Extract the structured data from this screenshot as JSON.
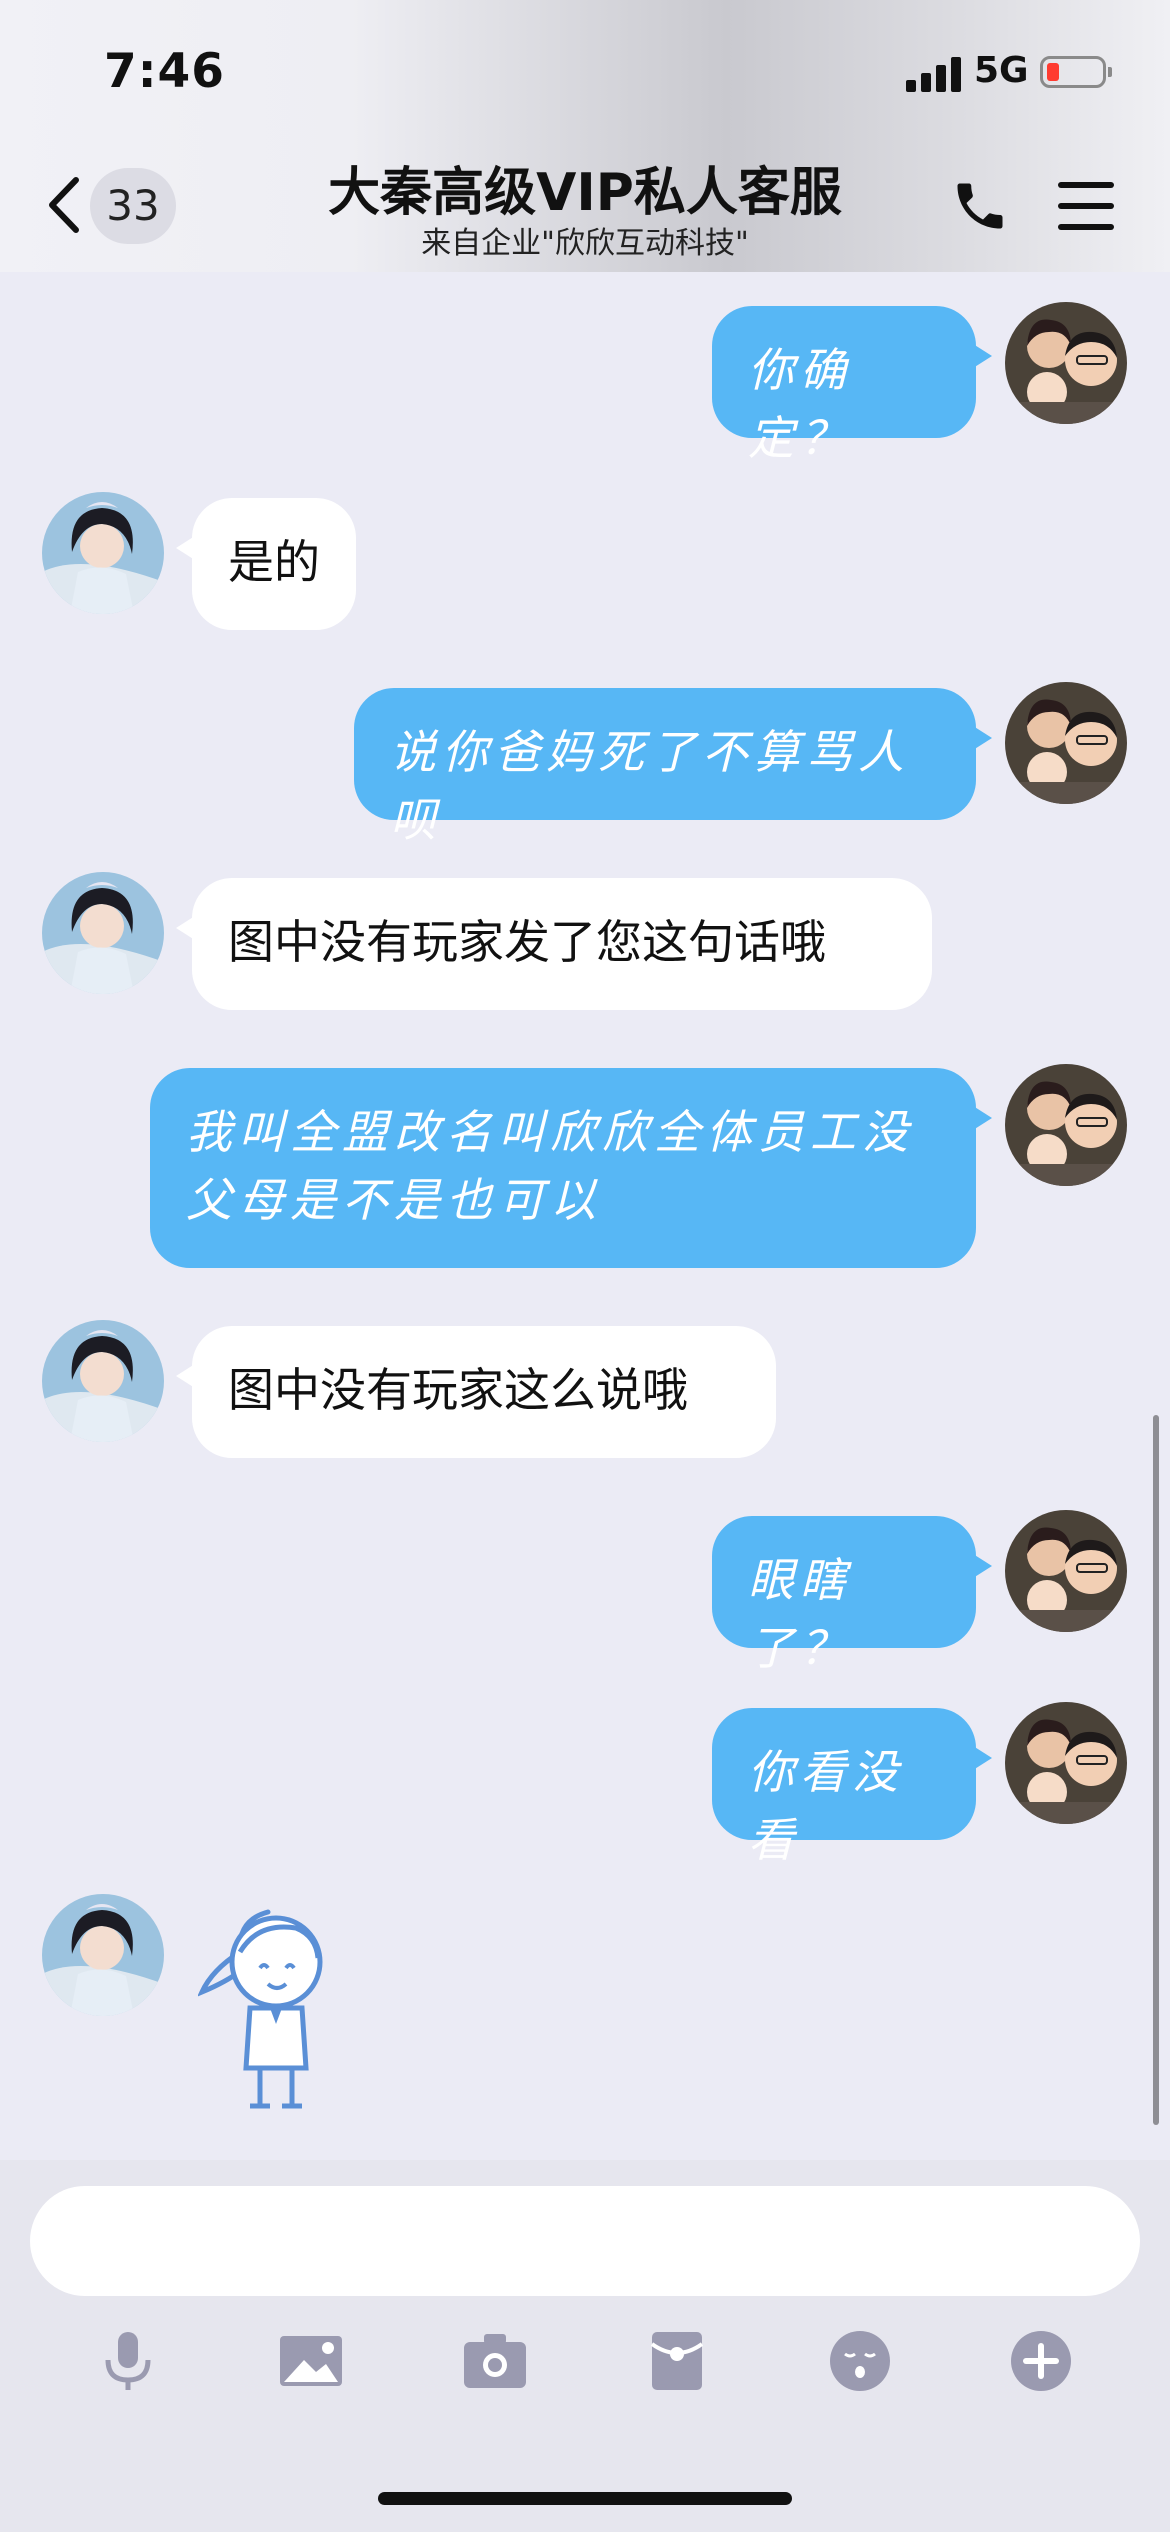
{
  "status_bar": {
    "time": "7:46",
    "network": "5G"
  },
  "nav": {
    "back_count": "33",
    "title": "大秦高级VIP私人客服",
    "subtitle": "来自企业\"欣欣互动科技\""
  },
  "messages": [
    {
      "side": "right",
      "text": "你确定？"
    },
    {
      "side": "left",
      "text": "是的"
    },
    {
      "side": "right",
      "text": "说你爸妈死了不算骂人呗"
    },
    {
      "side": "left",
      "text": "图中没有玩家发了您这句话哦"
    },
    {
      "side": "right",
      "text": "我叫全盟改名叫欣欣全体员工没父母是不是也可以"
    },
    {
      "side": "left",
      "text": "图中没有玩家这么说哦"
    },
    {
      "side": "right",
      "text": "眼瞎了？"
    },
    {
      "side": "right",
      "text": "你看没看"
    },
    {
      "side": "left",
      "type": "sticker",
      "icon": "cartoon-girl-sticker"
    }
  ],
  "input": {
    "value": "",
    "placeholder": ""
  },
  "toolbar": [
    "microphone-icon",
    "image-icon",
    "camera-icon",
    "red-packet-icon",
    "emoji-icon",
    "plus-icon"
  ],
  "colors": {
    "outgoing_bubble": "#57b7f5",
    "incoming_bubble": "#ffffff",
    "background": "#ebebf5",
    "toolbar_icon": "#9a9ab0"
  }
}
